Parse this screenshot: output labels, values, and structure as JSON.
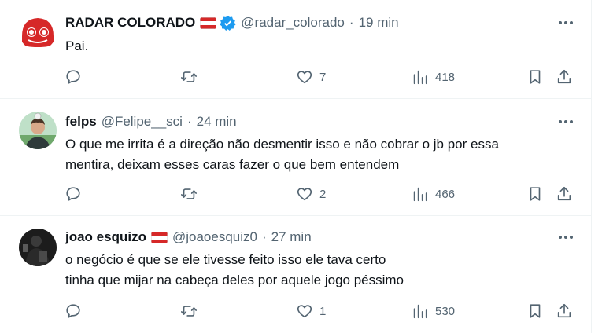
{
  "tweets": [
    {
      "name": "RADAR COLORADO",
      "has_flag": true,
      "verified": true,
      "handle": "@radar_colorado",
      "time": "19 min",
      "text_lines": [
        "Pai."
      ],
      "likes": "7",
      "views": "418"
    },
    {
      "name": "felps",
      "has_flag": false,
      "verified": false,
      "handle": "@Felipe__sci",
      "time": "24 min",
      "text_lines": [
        "O que me irrita é a direção não desmentir isso e não cobrar o jb por essa",
        "mentira, deixam esses caras fazer o que bem entendem"
      ],
      "likes": "2",
      "views": "466"
    },
    {
      "name": "joao esquizo",
      "has_flag": true,
      "verified": false,
      "handle": "@joaoesquiz0",
      "time": "27 min",
      "text_lines": [
        "o negócio é que se ele tivesse feito isso ele tava certo",
        "tinha que mijar na cabeça deles por aquele jogo péssimo"
      ],
      "likes": "1",
      "views": "530"
    }
  ],
  "separator": "·",
  "icons": {
    "more": "more-horizontal-icon",
    "reply": "reply-icon",
    "retweet": "retweet-icon",
    "like": "heart-icon",
    "views": "views-icon",
    "bookmark": "bookmark-icon",
    "share": "share-icon",
    "verified": "verified-badge-icon",
    "flag": "flag-icon"
  },
  "colors": {
    "text": "#0f1419",
    "secondary": "#536471",
    "verified": "#1d9bf0",
    "brand_red": "#d62828",
    "divider": "#eff3f4"
  }
}
